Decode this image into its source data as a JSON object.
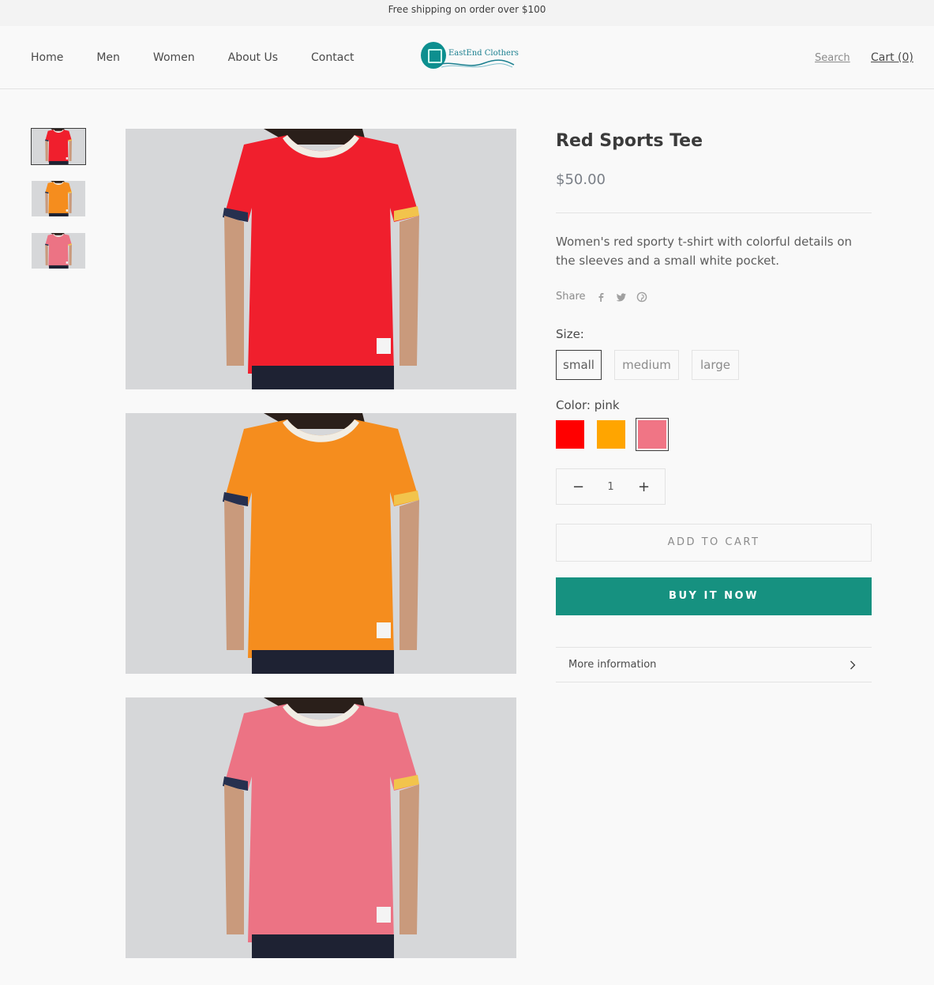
{
  "announcement": "Free shipping on order over $100",
  "nav": {
    "items": [
      "Home",
      "Men",
      "Women",
      "About Us",
      "Contact"
    ],
    "search": "Search",
    "cart": "Cart (0)"
  },
  "logo": {
    "text": "EastEnd Clothers",
    "icon": "shirt-logo-icon"
  },
  "product": {
    "title": "Red Sports Tee",
    "price": "$50.00",
    "description": "Women's red sporty t-shirt with colorful details on the sleeves and a small white pocket.",
    "share_label": "Share",
    "share_icons": [
      "facebook-icon",
      "twitter-icon",
      "pinterest-icon"
    ],
    "size_label": "Size:",
    "sizes": [
      "small",
      "medium",
      "large"
    ],
    "selected_size": "small",
    "color_label": "Color: pink",
    "colors": [
      {
        "name": "red",
        "hex": "#ff0000"
      },
      {
        "name": "orange",
        "hex": "#ffa500"
      },
      {
        "name": "pink",
        "hex": "#f07585"
      }
    ],
    "selected_color": "pink",
    "quantity": "1",
    "add_to_cart": "ADD TO CART",
    "buy_now": "BUY IT NOW",
    "more_info": "More information"
  },
  "gallery": {
    "shirt_colors": [
      "#f01f2d",
      "#f58d1e",
      "#ec7384"
    ],
    "trim_colors": {
      "collar": "#f1ede4",
      "left_cuff": "#26304f",
      "right_cuff": "#f2c44c"
    }
  },
  "colors": {
    "accent": "#169180",
    "border": "#e3e3e3",
    "text": "#5c5c5c"
  }
}
